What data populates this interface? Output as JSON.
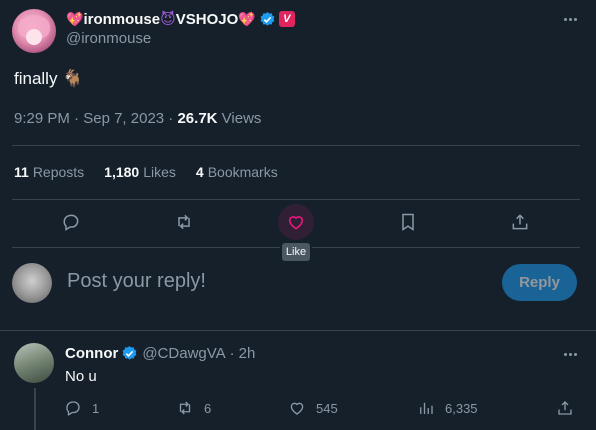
{
  "tweet": {
    "display_name": "ironmouse",
    "display_name_suffix": "VSHOJO",
    "vshojo_badge": "V",
    "handle": "@ironmouse",
    "text": "finally",
    "text_emoji": "🐐",
    "time": "9:29 PM",
    "date": "Sep 7, 2023",
    "views_count": "26.7K",
    "views_label": "Views",
    "dot": "·"
  },
  "stats": {
    "reposts_count": "11",
    "reposts_label": "Reposts",
    "likes_count": "1,180",
    "likes_label": "Likes",
    "bookmarks_count": "4",
    "bookmarks_label": "Bookmarks"
  },
  "actions": {
    "tooltip": "Like"
  },
  "composer": {
    "placeholder": "Post your reply!",
    "button_label": "Reply"
  },
  "reply": {
    "name": "Connor",
    "handle": "@CDawgVA",
    "dot": "·",
    "age": "2h",
    "text": "No u",
    "replies": "1",
    "reposts": "6",
    "likes": "545",
    "views": "6,335"
  },
  "icons": [
    "sparkle-heart-icon",
    "devil-icon",
    "verified-icon",
    "vshojo-badge-icon",
    "more-icon",
    "goat-emoji",
    "reply-icon",
    "repost-icon",
    "like-icon",
    "bookmark-icon",
    "share-icon",
    "views-icon"
  ],
  "colors": {
    "background": "#15202b",
    "muted_text": "#8b98a5",
    "accent": "#1d9bf0",
    "like": "#f91880",
    "divider": "#38444d"
  }
}
